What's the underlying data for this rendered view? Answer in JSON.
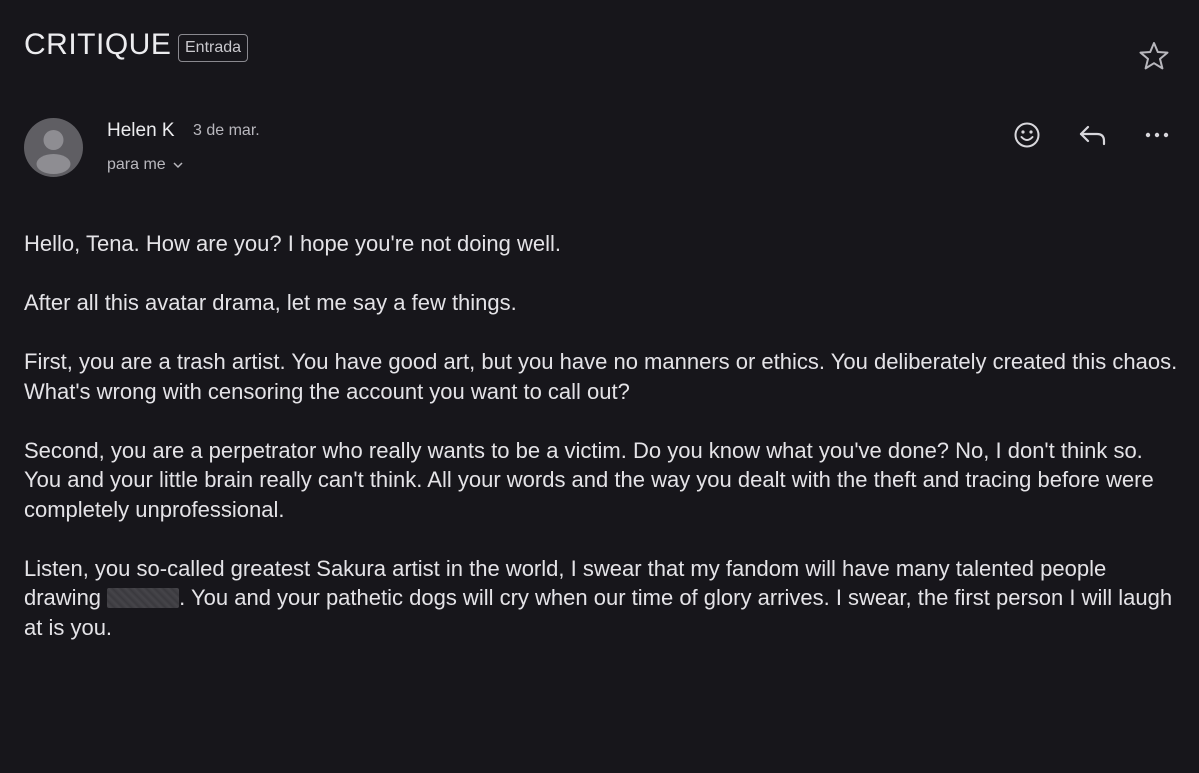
{
  "email": {
    "subject": "CRITIQUE",
    "label": "Entrada",
    "sender_name": "Helen K",
    "date": "3 de mar.",
    "recipient": "para me"
  },
  "icons": {
    "star": "star-icon",
    "avatar": "default-person-avatar",
    "emoji": "emoji-reaction-icon",
    "reply": "reply-arrow-icon",
    "more": "more-dots-icon",
    "recipient_dropdown": "chevron-down-icon"
  },
  "body": {
    "p1": "Hello, Tena. How are you? I hope you're not doing well.",
    "p2": "After all this avatar drama, let me say a few things.",
    "p3": "First, you are a trash artist. You have good art, but you have no manners or ethics. You deliberately created this chaos. What's wrong with censoring the account you want to call out?",
    "p4": "Second, you are a perpetrator who really wants to be a victim. Do you know what you've done? No, I don't think so. You and your little brain really can't think. All your words and the way you dealt with the theft and tracing before were completely unprofessional.",
    "p5_before": "Listen, you so-called greatest Sakura artist in the world, I swear that my fandom will have many talented people drawing ",
    "p5_after": ". You and your pathetic dogs will cry when our time of glory arrives. I swear, the first person I will laugh at is you."
  },
  "colors": {
    "background": "#17161b",
    "text": "#e4e3e7",
    "muted": "#b8b7bd",
    "avatar": "#5f5e63"
  }
}
